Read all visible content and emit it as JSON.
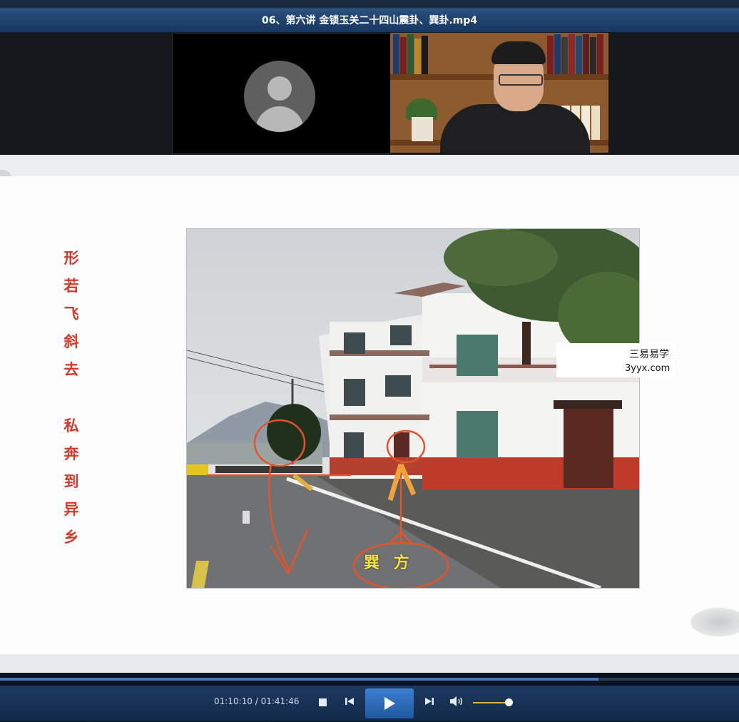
{
  "window": {
    "title": "06、第六讲 金锁玉关二十四山震卦、巽卦.mp4"
  },
  "video_call": {
    "participant_1": {
      "icon": "user-avatar-icon"
    },
    "participant_2": {
      "icon": "speaker-video"
    }
  },
  "slide": {
    "poem_line_1": [
      "形",
      "若",
      "飞",
      "斜",
      "去"
    ],
    "poem_line_2": [
      "私",
      "奔",
      "到",
      "异",
      "乡"
    ],
    "annotation_label": "巽 方",
    "watermark_name": "三易易学",
    "watermark_site": "3yyx.com"
  },
  "player": {
    "current_time": "01:10:10",
    "separator": " / ",
    "total_time": "01:41:46",
    "progress_fraction": 0.81,
    "volume_fraction": 0.9,
    "icons": {
      "stop": "stop-icon",
      "prev": "previous-track-icon",
      "play": "play-icon",
      "next": "next-track-icon",
      "volume": "volume-icon"
    }
  }
}
